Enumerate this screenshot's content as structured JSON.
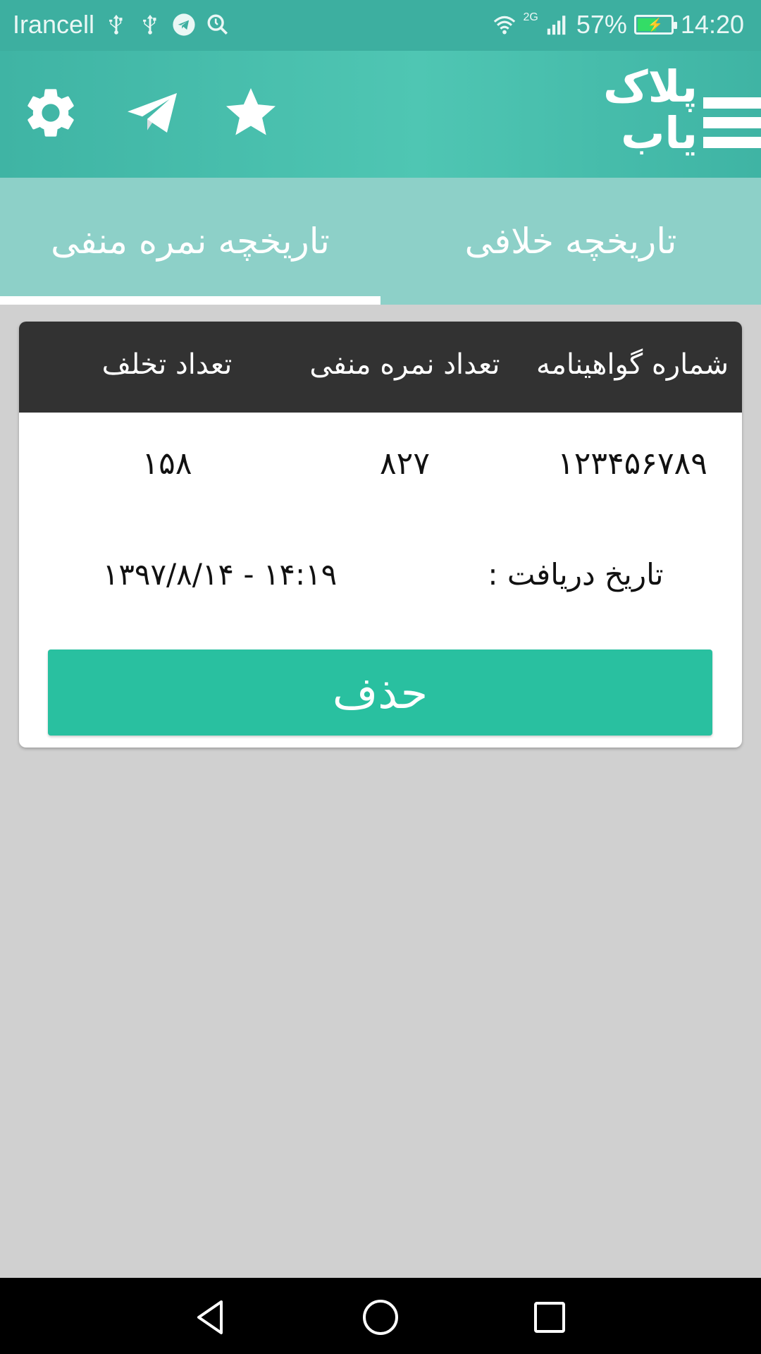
{
  "status_bar": {
    "carrier": "Irancell",
    "network": "2G",
    "battery": "57%",
    "battery_level": 0.57,
    "time": "14:20",
    "icons": [
      "usb-icon",
      "usb-icon",
      "telegram-icon",
      "search-icon",
      "wifi-icon",
      "signal-icon",
      "battery-icon"
    ]
  },
  "app_bar": {
    "logo_text": "پلاک\nیاب",
    "icons": [
      "settings-icon",
      "telegram-icon",
      "star-icon",
      "hamburger-icon"
    ]
  },
  "tabs": [
    {
      "label": "تاریخچه خلافی",
      "selected": false
    },
    {
      "label": "تاریخچه نمره منفی",
      "selected": true
    }
  ],
  "table": {
    "headers": [
      "شماره گواهینامه",
      "تعداد نمره منفی",
      "تعداد تخلف"
    ],
    "row": [
      "۱۲۳۴۵۶۷۸۹",
      "۸۲۷",
      "۱۵۸"
    ],
    "date_label": "تاریخ دریافت :",
    "date_value": "۱۴:۱۹ - ۱۳۹۷/۸/۱۴"
  },
  "delete_button": "حذف",
  "colors": {
    "status_bar": "#3dafa0",
    "app_bar": "#4fc6b3",
    "tab_bar": "#8dd0c8",
    "header": "#323232",
    "button": "#29c0a0",
    "background": "#d0d0d0"
  }
}
